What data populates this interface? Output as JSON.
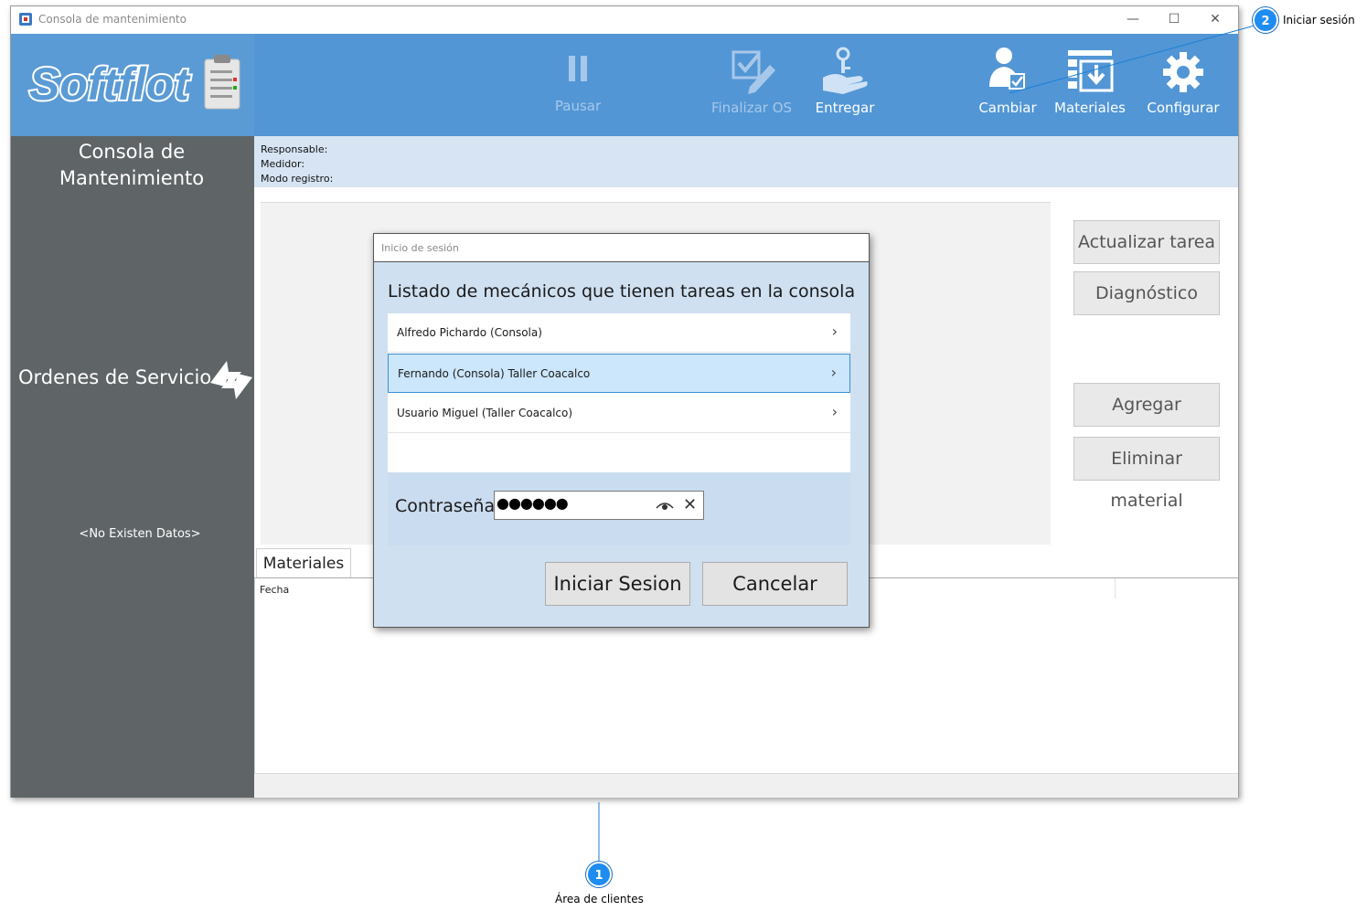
{
  "window": {
    "title": "Consola de mantenimiento",
    "controls": {
      "minimize": "—",
      "maximize": "☐",
      "close": "✕"
    }
  },
  "logo": {
    "text": "Softflot"
  },
  "ribbon": {
    "pause": "Pausar",
    "finish_os": "Finalizar OS",
    "deliver": "Entregar",
    "change": "Cambiar",
    "materials": "Materiales",
    "configure": "Configurar"
  },
  "sidebar": {
    "title_line1": "Consola de",
    "title_line2": "Mantenimiento",
    "orders_label": "Ordenes de Servicio",
    "no_data": "<No Existen Datos>"
  },
  "info": {
    "responsable": "Responsable:",
    "medidor": "Medidor:",
    "modo_registro": "Modo registro:"
  },
  "actions": {
    "update_task": "Actualizar tarea",
    "diagnostic": "Diagnóstico",
    "add_material": "Agregar material",
    "remove_material": "Eliminar material"
  },
  "materials_tab": {
    "label": "Materiales",
    "columns": [
      "Fecha"
    ]
  },
  "dialog": {
    "title": "Inicio de sesión",
    "heading": "Listado de mecánicos que tienen tareas en la consola",
    "mechanics": [
      "Alfredo Pichardo (Consola)",
      "Fernando (Consola) Taller Coacalco",
      "Usuario Miguel (Taller Coacalco)"
    ],
    "selected_index": 1,
    "password_label": "Contraseña:",
    "password_value": "●●●●●●",
    "login_button": "Iniciar Sesion",
    "cancel_button": "Cancelar"
  },
  "callouts": [
    {
      "number": "1",
      "label": "Área de clientes"
    },
    {
      "number": "2",
      "label": "Iniciar sesión"
    }
  ],
  "colors": {
    "ribbon": "#5296d5",
    "sidebar": "#5f6567",
    "infobar": "#d6e4f3",
    "dialog_bg": "#cfe0f1",
    "selected_item": "#cce6fb",
    "callout": "#1e8cf0"
  }
}
